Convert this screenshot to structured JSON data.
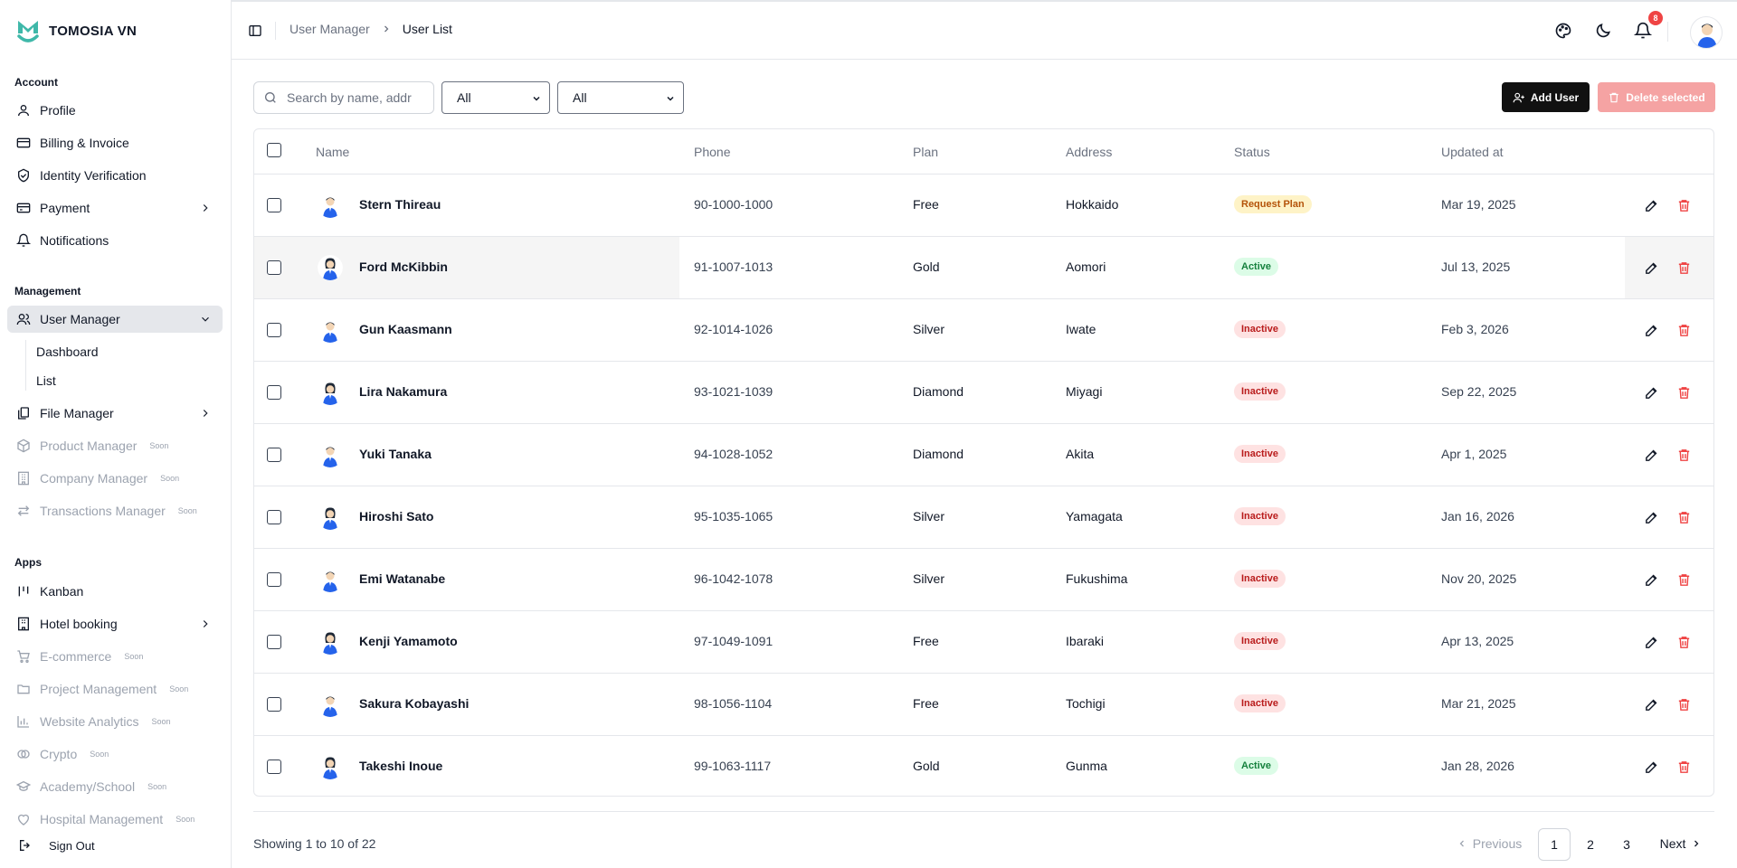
{
  "brand": {
    "name": "TOMOSIA VN"
  },
  "sidebar": {
    "sections": {
      "account": "Account",
      "management": "Management",
      "apps": "Apps"
    },
    "account_items": [
      {
        "label": "Profile",
        "icon": "user-icon"
      },
      {
        "label": "Billing & Invoice",
        "icon": "card-icon"
      },
      {
        "label": "Identity Verification",
        "icon": "shield-check-icon"
      },
      {
        "label": "Payment",
        "icon": "wallet-icon"
      },
      {
        "label": "Notifications",
        "icon": "bell-icon"
      }
    ],
    "management_items": [
      {
        "label": "User Manager",
        "icon": "users-icon"
      },
      {
        "label": "File Manager",
        "icon": "files-icon"
      },
      {
        "label": "Product Manager",
        "icon": "box-icon",
        "soon": "Soon"
      },
      {
        "label": "Company Manager",
        "icon": "building-icon",
        "soon": "Soon"
      },
      {
        "label": "Transactions Manager",
        "icon": "arrows-icon",
        "soon": "Soon"
      }
    ],
    "user_manager_sub": [
      "Dashboard",
      "List"
    ],
    "apps_items": [
      {
        "label": "Kanban",
        "icon": "kanban-icon"
      },
      {
        "label": "Hotel booking",
        "icon": "hotel-icon"
      },
      {
        "label": "E-commerce",
        "icon": "cart-icon",
        "soon": "Soon"
      },
      {
        "label": "Project Management",
        "icon": "folder-icon",
        "soon": "Soon"
      },
      {
        "label": "Website Analytics",
        "icon": "chart-icon",
        "soon": "Soon"
      },
      {
        "label": "Crypto",
        "icon": "coin-icon",
        "soon": "Soon"
      },
      {
        "label": "Academy/School",
        "icon": "graduation-icon",
        "soon": "Soon"
      },
      {
        "label": "Hospital Management",
        "icon": "heart-icon",
        "soon": "Soon"
      }
    ],
    "sign_out": "Sign Out"
  },
  "header": {
    "breadcrumb": [
      "User Manager",
      "User List"
    ],
    "notification_count": "8"
  },
  "toolbar": {
    "search_placeholder": "Search by name, addr",
    "filter1": "All",
    "filter2": "All",
    "add_user": "Add User",
    "delete_selected": "Delete selected"
  },
  "table": {
    "columns": [
      "Name",
      "Phone",
      "Plan",
      "Address",
      "Status",
      "Updated at"
    ],
    "rows": [
      {
        "name": "Stern Thireau",
        "phone": "90-1000-1000",
        "plan": "Free",
        "address": "Hokkaido",
        "status": "Request Plan",
        "status_type": "request",
        "updated": "Mar 19, 2025",
        "avatar": "male"
      },
      {
        "name": "Ford McKibbin",
        "phone": "91-1007-1013",
        "plan": "Gold",
        "address": "Aomori",
        "status": "Active",
        "status_type": "active",
        "updated": "Jul 13, 2025",
        "avatar": "female"
      },
      {
        "name": "Gun Kaasmann",
        "phone": "92-1014-1026",
        "plan": "Silver",
        "address": "Iwate",
        "status": "Inactive",
        "status_type": "inactive",
        "updated": "Feb 3, 2026",
        "avatar": "male"
      },
      {
        "name": "Lira Nakamura",
        "phone": "93-1021-1039",
        "plan": "Diamond",
        "address": "Miyagi",
        "status": "Inactive",
        "status_type": "inactive",
        "updated": "Sep 22, 2025",
        "avatar": "female"
      },
      {
        "name": "Yuki Tanaka",
        "phone": "94-1028-1052",
        "plan": "Diamond",
        "address": "Akita",
        "status": "Inactive",
        "status_type": "inactive",
        "updated": "Apr 1, 2025",
        "avatar": "male"
      },
      {
        "name": "Hiroshi Sato",
        "phone": "95-1035-1065",
        "plan": "Silver",
        "address": "Yamagata",
        "status": "Inactive",
        "status_type": "inactive",
        "updated": "Jan 16, 2026",
        "avatar": "female"
      },
      {
        "name": "Emi Watanabe",
        "phone": "96-1042-1078",
        "plan": "Silver",
        "address": "Fukushima",
        "status": "Inactive",
        "status_type": "inactive",
        "updated": "Nov 20, 2025",
        "avatar": "male"
      },
      {
        "name": "Kenji Yamamoto",
        "phone": "97-1049-1091",
        "plan": "Free",
        "address": "Ibaraki",
        "status": "Inactive",
        "status_type": "inactive",
        "updated": "Apr 13, 2025",
        "avatar": "female"
      },
      {
        "name": "Sakura Kobayashi",
        "phone": "98-1056-1104",
        "plan": "Free",
        "address": "Tochigi",
        "status": "Inactive",
        "status_type": "inactive",
        "updated": "Mar 21, 2025",
        "avatar": "male"
      },
      {
        "name": "Takeshi Inoue",
        "phone": "99-1063-1117",
        "plan": "Gold",
        "address": "Gunma",
        "status": "Active",
        "status_type": "active",
        "updated": "Jan 28, 2026",
        "avatar": "female"
      }
    ]
  },
  "footer": {
    "showing": "Showing 1 to 10 of 22",
    "previous": "Previous",
    "pages": [
      "1",
      "2",
      "3"
    ],
    "next": "Next"
  },
  "colors": {
    "accent": "#111111",
    "brand": "#3fb8a9",
    "danger": "#ef4444"
  }
}
